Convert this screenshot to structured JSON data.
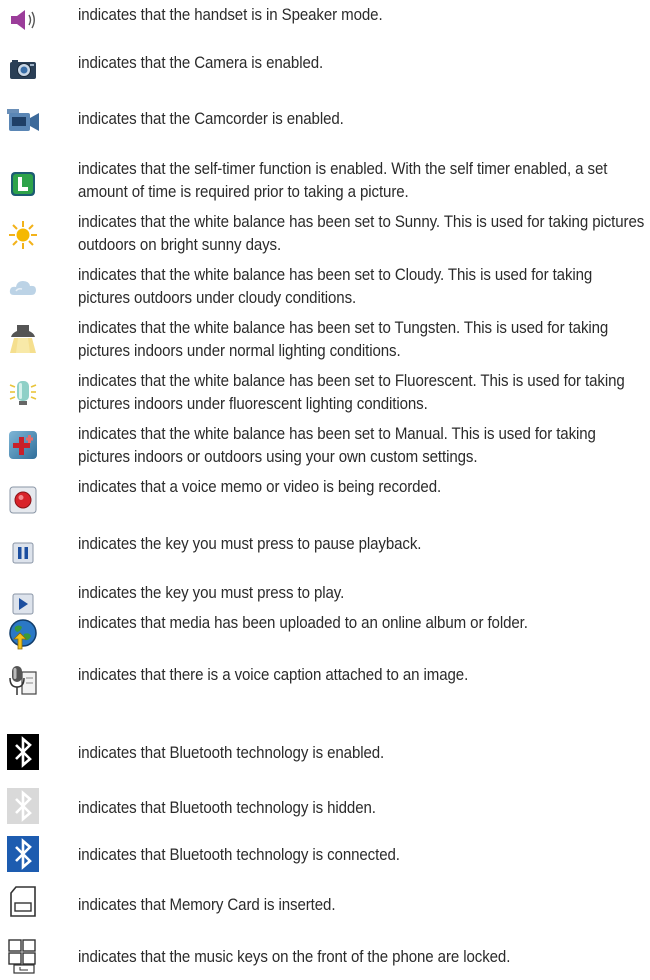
{
  "items": [
    {
      "icon": "speaker-icon",
      "text": "indicates that the handset is in Speaker mode."
    },
    {
      "icon": "camera-icon",
      "text": "indicates that the Camera is enabled."
    },
    {
      "icon": "camcorder-icon",
      "text": "indicates that the Camcorder is enabled."
    },
    {
      "icon": "self-timer-icon",
      "text": "indicates that the self-timer function is enabled. With the self timer enabled, a set amount of time is required prior to taking a picture."
    },
    {
      "icon": "white-balance-sunny-icon",
      "text": "indicates that the white balance has been set to Sunny. This is used for taking pictures outdoors on bright sunny days."
    },
    {
      "icon": "white-balance-cloudy-icon",
      "text": "indicates that the white balance has been set to Cloudy. This is used for taking pictures outdoors under cloudy conditions."
    },
    {
      "icon": "white-balance-tungsten-icon",
      "text": "indicates that the white balance has been set to Tungsten. This is used for taking pictures indoors under normal lighting conditions."
    },
    {
      "icon": "white-balance-fluorescent-icon",
      "text": "indicates that the white balance has been set to Fluorescent. This is used for taking pictures indoors under fluorescent lighting conditions."
    },
    {
      "icon": "white-balance-manual-icon",
      "text": "indicates that the white balance has been set to Manual. This is used for taking pictures indoors or outdoors using your own custom settings."
    },
    {
      "icon": "record-icon",
      "text": "indicates that a voice memo or video is being recorded."
    },
    {
      "icon": "pause-icon",
      "text": "indicates the key you must press to pause playback."
    },
    {
      "icon": "play-icon",
      "text": "indicates the key you must press to play."
    },
    {
      "icon": "online-album-upload-icon",
      "text": "indicates that media has been uploaded to an online album or folder."
    },
    {
      "icon": "voice-caption-icon",
      "text": "indicates that there is a voice caption attached to an image."
    },
    {
      "icon": "bluetooth-enabled-icon",
      "text": "indicates that Bluetooth technology is enabled."
    },
    {
      "icon": "bluetooth-hidden-icon",
      "text": "indicates that Bluetooth technology is hidden."
    },
    {
      "icon": "bluetooth-connected-icon",
      "text": "indicates that Bluetooth technology is connected."
    },
    {
      "icon": "memory-card-icon",
      "text": "indicates that Memory Card is inserted."
    },
    {
      "icon": "music-keys-locked-icon",
      "text": "indicates that the music keys on the front of the phone are locked."
    }
  ]
}
